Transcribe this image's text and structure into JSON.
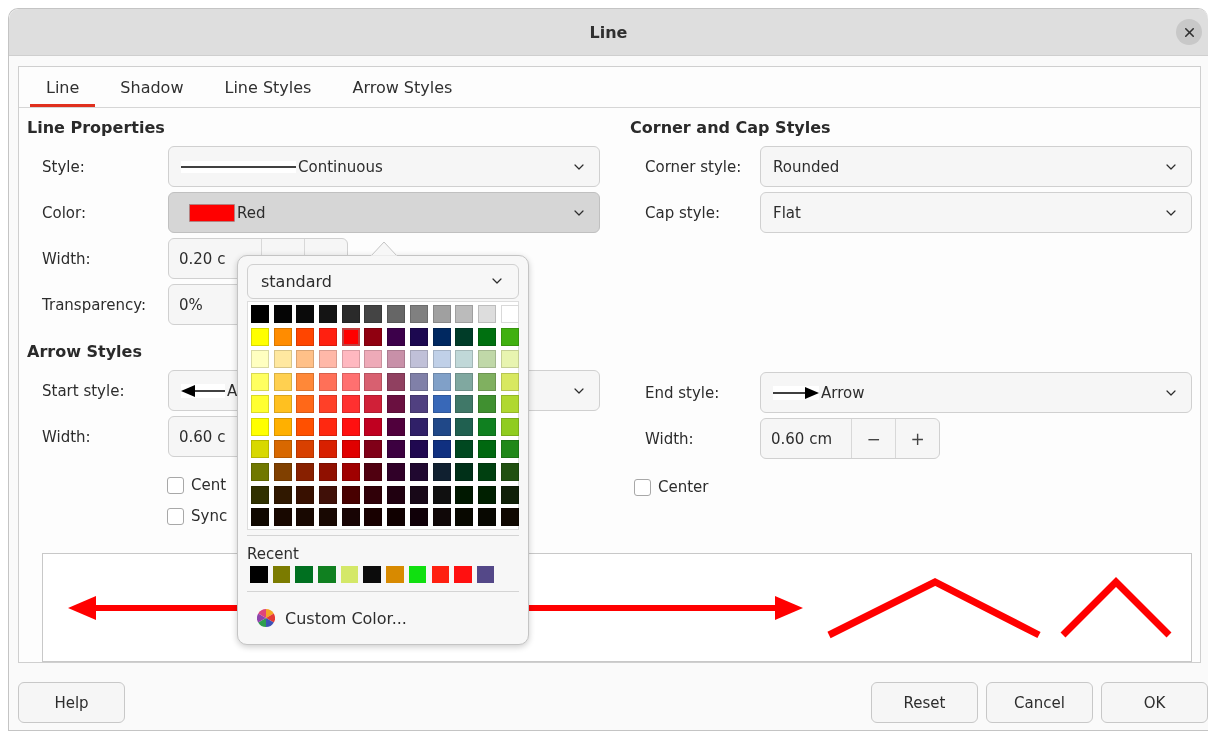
{
  "window": {
    "title": "Line"
  },
  "tabs": [
    {
      "label": "Line",
      "selected": true
    },
    {
      "label": "Shadow",
      "selected": false
    },
    {
      "label": "Line Styles",
      "selected": false
    },
    {
      "label": "Arrow Styles",
      "selected": false
    }
  ],
  "line_properties": {
    "heading": "Line Properties",
    "style": {
      "label": "Style:",
      "value": "Continuous"
    },
    "color": {
      "label": "Color:",
      "value": "Red",
      "color": "#ff0000"
    },
    "width": {
      "label": "Width:",
      "value": "0.20 c"
    },
    "transparency": {
      "label": "Transparency:",
      "value": "0%"
    }
  },
  "arrow_styles": {
    "heading": "Arrow Styles",
    "start_style": {
      "label": "Start style:",
      "value": "A"
    },
    "width": {
      "label": "Width:",
      "value": "0.60 c"
    },
    "checkboxes": [
      {
        "label": "Cent",
        "checked": false
      },
      {
        "label": "Sync",
        "checked": false
      }
    ]
  },
  "corner_cap": {
    "heading": "Corner and Cap Styles",
    "corner_style": {
      "label": "Corner style:",
      "value": "Rounded"
    },
    "cap_style": {
      "label": "Cap style:",
      "value": "Flat"
    }
  },
  "end_arrow": {
    "end_style": {
      "label": "End style:",
      "value": "Arrow"
    },
    "width": {
      "label": "Width:",
      "value": "0.60 cm",
      "minus": "−",
      "plus": "+"
    },
    "center": {
      "label": "Center",
      "checked": false
    }
  },
  "color_popup": {
    "palette_name": "standard",
    "palette": [
      [
        {
          "color": "#000000",
          "selected": false
        },
        {
          "color": "#050505",
          "selected": false
        },
        {
          "color": "#0a0a0a",
          "selected": false
        },
        {
          "color": "#141414",
          "selected": false
        },
        {
          "color": "#2a2a2a",
          "selected": false
        },
        {
          "color": "#444444",
          "selected": false
        },
        {
          "color": "#666666",
          "selected": false
        },
        {
          "color": "#808080",
          "selected": false
        },
        {
          "color": "#a0a0a0",
          "selected": false
        },
        {
          "color": "#bbbbbb",
          "selected": false
        },
        {
          "color": "#dddddd",
          "selected": false
        },
        {
          "color": "#ffffff",
          "selected": false
        }
      ],
      [
        {
          "color": "#ffff00",
          "selected": false
        },
        {
          "color": "#ff8c00",
          "selected": false
        },
        {
          "color": "#ff4500",
          "selected": false
        },
        {
          "color": "#ff2010",
          "selected": false
        },
        {
          "color": "#ff0000",
          "selected": true
        },
        {
          "color": "#900010",
          "selected": false
        },
        {
          "color": "#3c004a",
          "selected": false
        },
        {
          "color": "#1c0850",
          "selected": false
        },
        {
          "color": "#002860",
          "selected": false
        },
        {
          "color": "#003c28",
          "selected": false
        },
        {
          "color": "#007010",
          "selected": false
        },
        {
          "color": "#40b010",
          "selected": false
        }
      ],
      [
        {
          "color": "#ffffc0",
          "selected": false
        },
        {
          "color": "#ffe8a0",
          "selected": false
        },
        {
          "color": "#ffc088",
          "selected": false
        },
        {
          "color": "#ffb8a8",
          "selected": false
        },
        {
          "color": "#ffb8c0",
          "selected": false
        },
        {
          "color": "#eeaab8",
          "selected": false
        },
        {
          "color": "#c890a8",
          "selected": false
        },
        {
          "color": "#c0c0d8",
          "selected": false
        },
        {
          "color": "#c0d0e8",
          "selected": false
        },
        {
          "color": "#c0d8d8",
          "selected": false
        },
        {
          "color": "#c0d8a8",
          "selected": false
        },
        {
          "color": "#e8f4b0",
          "selected": false
        }
      ],
      [
        {
          "color": "#ffff60",
          "selected": false
        },
        {
          "color": "#ffd050",
          "selected": false
        },
        {
          "color": "#ff8838",
          "selected": false
        },
        {
          "color": "#ff7058",
          "selected": false
        },
        {
          "color": "#ff7070",
          "selected": false
        },
        {
          "color": "#d86070",
          "selected": false
        },
        {
          "color": "#904060",
          "selected": false
        },
        {
          "color": "#8080a8",
          "selected": false
        },
        {
          "color": "#80a0c8",
          "selected": false
        },
        {
          "color": "#80a8a0",
          "selected": false
        },
        {
          "color": "#80b060",
          "selected": false
        },
        {
          "color": "#d8e860",
          "selected": false
        }
      ],
      [
        {
          "color": "#ffff30",
          "selected": false
        },
        {
          "color": "#ffc020",
          "selected": false
        },
        {
          "color": "#ff6818",
          "selected": false
        },
        {
          "color": "#ff4028",
          "selected": false
        },
        {
          "color": "#ff3030",
          "selected": false
        },
        {
          "color": "#d02038",
          "selected": false
        },
        {
          "color": "#6a1040",
          "selected": false
        },
        {
          "color": "#504080",
          "selected": false
        },
        {
          "color": "#3868b8",
          "selected": false
        },
        {
          "color": "#407868",
          "selected": false
        },
        {
          "color": "#409030",
          "selected": false
        },
        {
          "color": "#b0d830",
          "selected": false
        }
      ],
      [
        {
          "color": "#ffff00",
          "selected": false
        },
        {
          "color": "#ffb000",
          "selected": false
        },
        {
          "color": "#ff5000",
          "selected": false
        },
        {
          "color": "#ff2810",
          "selected": false
        },
        {
          "color": "#ff1010",
          "selected": false
        },
        {
          "color": "#c00020",
          "selected": false
        },
        {
          "color": "#50003c",
          "selected": false
        },
        {
          "color": "#302068",
          "selected": false
        },
        {
          "color": "#204888",
          "selected": false
        },
        {
          "color": "#206050",
          "selected": false
        },
        {
          "color": "#108020",
          "selected": false
        },
        {
          "color": "#90cc20",
          "selected": false
        }
      ],
      [
        {
          "color": "#d8d800",
          "selected": false
        },
        {
          "color": "#d86800",
          "selected": false
        },
        {
          "color": "#d84000",
          "selected": false
        },
        {
          "color": "#d82000",
          "selected": false
        },
        {
          "color": "#e00000",
          "selected": false
        },
        {
          "color": "#800018",
          "selected": false
        },
        {
          "color": "#3c0040",
          "selected": false
        },
        {
          "color": "#200850",
          "selected": false
        },
        {
          "color": "#103080",
          "selected": false
        },
        {
          "color": "#004820",
          "selected": false
        },
        {
          "color": "#006810",
          "selected": false
        },
        {
          "color": "#208818",
          "selected": false
        }
      ],
      [
        {
          "color": "#707800",
          "selected": false
        },
        {
          "color": "#804000",
          "selected": false
        },
        {
          "color": "#882000",
          "selected": false
        },
        {
          "color": "#901000",
          "selected": false
        },
        {
          "color": "#a00000",
          "selected": false
        },
        {
          "color": "#500010",
          "selected": false
        },
        {
          "color": "#300028",
          "selected": false
        },
        {
          "color": "#200830",
          "selected": false
        },
        {
          "color": "#102030",
          "selected": false
        },
        {
          "color": "#003018",
          "selected": false
        },
        {
          "color": "#004010",
          "selected": false
        },
        {
          "color": "#205010",
          "selected": false
        }
      ],
      [
        {
          "color": "#303000",
          "selected": false
        },
        {
          "color": "#301800",
          "selected": false
        },
        {
          "color": "#381000",
          "selected": false
        },
        {
          "color": "#401008",
          "selected": false
        },
        {
          "color": "#480000",
          "selected": false
        },
        {
          "color": "#300008",
          "selected": false
        },
        {
          "color": "#200010",
          "selected": false
        },
        {
          "color": "#180818",
          "selected": false
        },
        {
          "color": "#101010",
          "selected": false
        },
        {
          "color": "#001800",
          "selected": false
        },
        {
          "color": "#002000",
          "selected": false
        },
        {
          "color": "#102008",
          "selected": false
        }
      ],
      [
        {
          "color": "#100800",
          "selected": false
        },
        {
          "color": "#180800",
          "selected": false
        },
        {
          "color": "#180801",
          "selected": false
        },
        {
          "color": "#180802",
          "selected": false
        },
        {
          "color": "#180404",
          "selected": false
        },
        {
          "color": "#180000",
          "selected": false
        },
        {
          "color": "#100000",
          "selected": false
        },
        {
          "color": "#100008",
          "selected": false
        },
        {
          "color": "#100808",
          "selected": false
        },
        {
          "color": "#080800",
          "selected": false
        },
        {
          "color": "#080801",
          "selected": false
        },
        {
          "color": "#100801",
          "selected": false
        }
      ]
    ],
    "recent_label": "Recent",
    "recent": [
      {
        "color": "#000000"
      },
      {
        "color": "#7b7b00"
      },
      {
        "color": "#007020"
      },
      {
        "color": "#108020"
      },
      {
        "color": "#d4e868"
      },
      {
        "color": "#0c0c0c"
      },
      {
        "color": "#d88a00"
      },
      {
        "color": "#10e010"
      },
      {
        "color": "#ff2010"
      },
      {
        "color": "#ff1010"
      },
      {
        "color": "#544888"
      }
    ],
    "custom_color": "Custom Color..."
  },
  "buttons": {
    "help": "Help",
    "reset": "Reset",
    "cancel": "Cancel",
    "ok": "OK"
  }
}
